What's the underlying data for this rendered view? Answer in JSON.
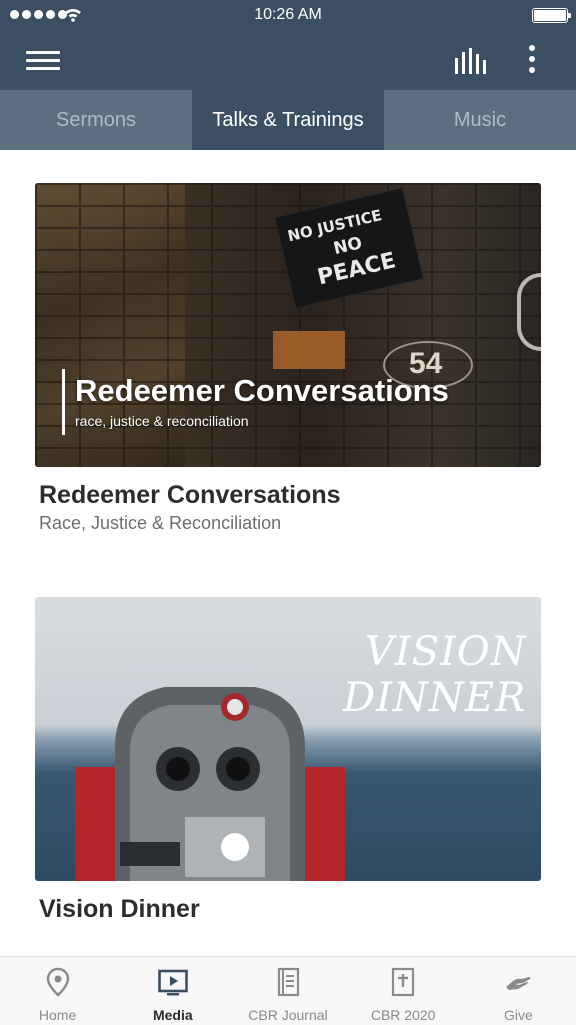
{
  "status_bar": {
    "time": "10:26 AM"
  },
  "tabs": [
    {
      "label": "Sermons",
      "active": false
    },
    {
      "label": "Talks & Trainings",
      "active": true
    },
    {
      "label": "Music",
      "active": false
    }
  ],
  "cards": [
    {
      "image_title": "Redeemer Conversations",
      "image_subtitle": "race, justice & reconciliation",
      "image_sign_text": [
        "NO JUSTICE",
        "NO",
        "PEACE"
      ],
      "image_plaque": "54",
      "title": "Redeemer Conversations",
      "subtitle": "Race, Justice & Reconciliation"
    },
    {
      "image_title_line1": "VISION",
      "image_title_line2": "DINNER",
      "title": "Vision Dinner"
    }
  ],
  "bottom_nav": [
    {
      "label": "Home",
      "icon": "location-pin-icon",
      "active": false
    },
    {
      "label": "Media",
      "icon": "play-screen-icon",
      "active": true
    },
    {
      "label": "CBR Journal",
      "icon": "journal-icon",
      "active": false
    },
    {
      "label": "CBR 2020",
      "icon": "bible-cross-icon",
      "active": false
    },
    {
      "label": "Give",
      "icon": "giving-hand-icon",
      "active": false
    }
  ],
  "colors": {
    "header": "#3c4f62",
    "tabs": "#5c6f80",
    "active_tab": "#3c4f62"
  }
}
